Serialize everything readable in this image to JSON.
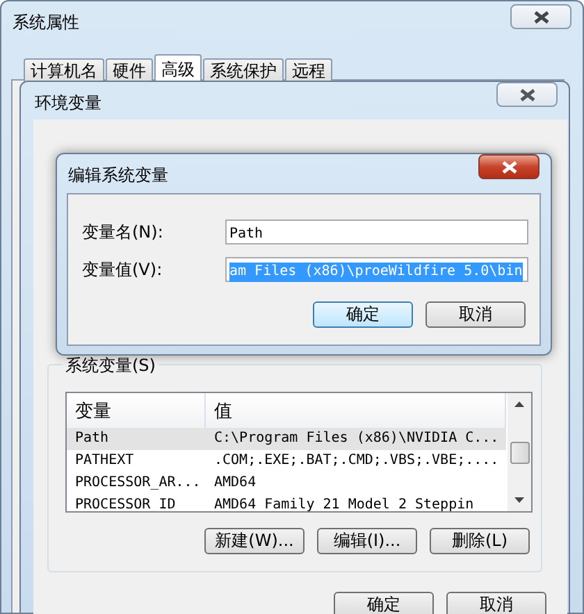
{
  "system_properties": {
    "title": "系统属性",
    "tabs": [
      {
        "label": "计算机名",
        "selected": false
      },
      {
        "label": "硬件",
        "selected": false
      },
      {
        "label": "高级",
        "selected": true
      },
      {
        "label": "系统保护",
        "selected": false
      },
      {
        "label": "远程",
        "selected": false
      }
    ]
  },
  "environment_variables": {
    "title": "环境变量",
    "system_variables": {
      "label": "系统变量(S)",
      "columns": [
        "变量",
        "值"
      ],
      "rows": [
        {
          "cells": [
            "Path",
            "C:\\Program Files (x86)\\NVIDIA C..."
          ],
          "selected": true
        },
        {
          "cells": [
            "PATHEXT",
            ".COM;.EXE;.BAT;.CMD;.VBS;.VBE;...."
          ],
          "selected": false
        },
        {
          "cells": [
            "PROCESSOR_AR...",
            "AMD64"
          ],
          "selected": false
        },
        {
          "cells": [
            "PROCESSOR_ID",
            "AMD64 Family 21 Model 2 Steppin"
          ],
          "selected": false
        }
      ],
      "buttons": [
        "新建(W)...",
        "编辑(I)...",
        "删除(L)"
      ]
    },
    "buttons": [
      "确定",
      "取消"
    ]
  },
  "edit_dialog": {
    "title": "编辑系统变量",
    "name_label": "变量名(N):",
    "name_value": "Path",
    "value_label": "变量值(V):",
    "value_value": "am Files (x86)\\proeWildfire 5.0\\bin",
    "value_text_selected": true,
    "buttons": [
      {
        "label": "确定",
        "default": true
      },
      {
        "label": "取消",
        "default": false
      }
    ]
  }
}
